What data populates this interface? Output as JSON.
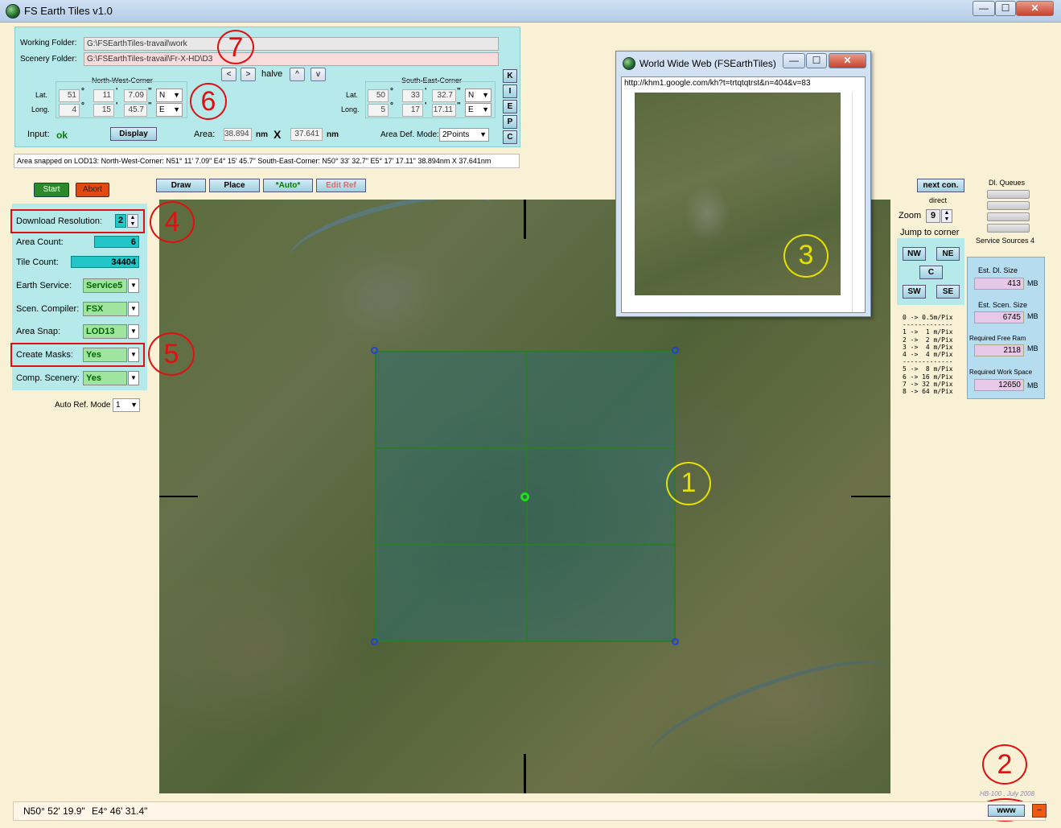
{
  "window": {
    "title": "FS Earth Tiles   v1.0",
    "min": "—",
    "max": "☐",
    "close": "✕"
  },
  "folders": {
    "working_label": "Working Folder:",
    "working_value": "G:\\FSEarthTiles-travail\\work",
    "scenery_label": "Scenery Folder:",
    "scenery_value": "G:\\FSEarthTiles-travail\\Fr-X-HD\\D3"
  },
  "nav": {
    "prev": "<",
    "next": ">",
    "halve": "halve",
    "up": "^",
    "down": "v"
  },
  "nw": {
    "title": "North-West-Corner",
    "lat_label": "Lat.",
    "long_label": "Long.",
    "lat_deg": "51",
    "lat_min": "11",
    "lat_sec": "7.09",
    "lat_dir": "N",
    "long_deg": "4",
    "long_min": "15",
    "long_sec": "45.7",
    "long_dir": "E"
  },
  "se": {
    "title": "South-East-Corner",
    "lat_label": "Lat.",
    "long_label": "Long.",
    "lat_deg": "50",
    "lat_min": "33",
    "lat_sec": "32.7",
    "lat_dir": "N",
    "long_deg": "5",
    "long_min": "17",
    "long_sec": "17.11",
    "long_dir": "E"
  },
  "symbols": {
    "deg": "°",
    "min": "'",
    "sec": "\""
  },
  "side_buttons": [
    "K",
    "I",
    "E",
    "P",
    "C"
  ],
  "input": {
    "label": "Input:",
    "status": "ok",
    "display_btn": "Display",
    "area_label": "Area:",
    "area_w": "38.894",
    "unit": "nm",
    "x": "X",
    "area_h": "37.641",
    "mode_label": "Area Def. Mode:",
    "mode_value": "2Points"
  },
  "lod_info": "Area snapped on LOD13:   North-West-Corner: N51° 11' 7.09\"   E4° 15' 45.7\"    South-East-Corner: N50° 33' 32.7\"   E5° 17' 17.11\"    38.894nm X 37.641nm",
  "actions": {
    "start": "Start",
    "abort": "Abort"
  },
  "toolbar": {
    "draw": "Draw",
    "place": "Place",
    "auto": "*Auto*",
    "edit_ref": "Edit Ref"
  },
  "settings": {
    "download_res_label": "Download Resolution:",
    "download_res_value": "2",
    "area_count_label": "Area Count:",
    "area_count_value": "6",
    "tile_count_label": "Tile Count:",
    "tile_count_value": "34404",
    "earth_service_label": "Earth Service:",
    "earth_service_value": "Service5",
    "compiler_label": "Scen. Compiler:",
    "compiler_value": "FSX",
    "snap_label": "Area Snap:",
    "snap_value": "LOD13",
    "masks_label": "Create Masks:",
    "masks_value": "Yes",
    "comp_label": "Comp. Scenery:",
    "comp_value": "Yes",
    "auto_ref_label": "Auto Ref. Mode",
    "auto_ref_value": "1"
  },
  "right": {
    "next_con": "next con.",
    "direct": "direct",
    "zoom_label": "Zoom",
    "zoom_value": "9",
    "jump_label": "Jump to corner",
    "nw": "NW",
    "ne": "NE",
    "c": "C",
    "sw": "SW",
    "se": "SE",
    "dl_queues": "Dl. Queues",
    "service_sources": "Service Sources 4",
    "res_table": "0 -> 0.5m/Pix\n-------------\n1 ->  1 m/Pix\n2 ->  2 m/Pix\n3 ->  4 m/Pix\n4 ->  4 m/Pix\n-------------\n5 ->  8 m/Pix\n6 -> 16 m/Pix\n7 -> 32 m/Pix\n8 -> 64 m/Pix",
    "est_dl_label": "Est. Dl. Size",
    "est_dl_value": "413",
    "est_dl_unit": "MB",
    "est_scen_label": "Est. Scen. Size",
    "est_scen_value": "6745",
    "est_scen_unit": "MB",
    "ram_label": "Required Free Ram",
    "ram_value": "2118",
    "ram_unit": "MB",
    "work_label": "Required Work Space",
    "work_value": "12650",
    "work_unit": "MB"
  },
  "www_window": {
    "title": "World Wide Web   (FSEarthTiles)",
    "url": "http://khm1.google.com/kh?t=trtqtqtrst&n=404&v=83"
  },
  "annotations": {
    "a1": "1",
    "a2": "2",
    "a3": "3",
    "a4": "4",
    "a5": "5",
    "a6": "6",
    "a7": "7"
  },
  "status": {
    "lat": "N50° 52' 19.9\"",
    "long": "E4° 46' 31.4\"",
    "credit": "HB-100 , July 2008",
    "www_btn": "www",
    "extra_btn": "~"
  }
}
